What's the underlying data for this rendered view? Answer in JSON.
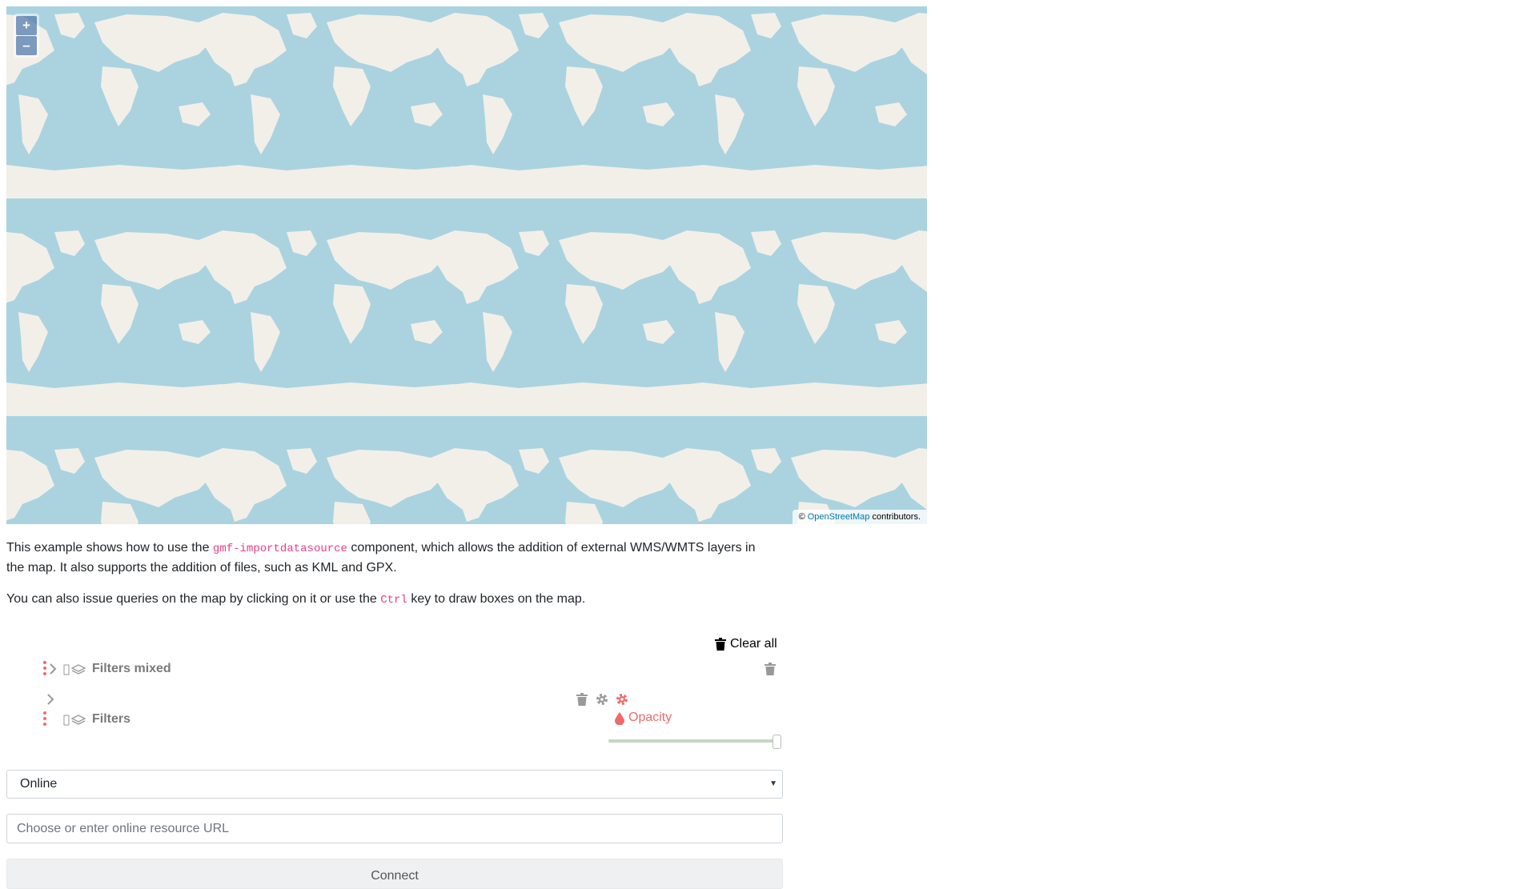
{
  "map": {
    "zoom_in": "+",
    "zoom_out": "–",
    "attribution_prefix": "©",
    "attribution_link": "OpenStreetMap",
    "attribution_suffix": "contributors.",
    "colors": {
      "water": "#aad3df",
      "land": "#f2efe9"
    }
  },
  "description": {
    "p1_before": "This example shows how to use the",
    "p1_code": "gmf-importdatasource",
    "p1_after": "component, which allows the addition of external WMS/WMTS layers in the map. It also supports the addition of files, such as KML and GPX.",
    "p2_before": "You can also issue queries on the map by clicking on it or use the",
    "p2_code": "Ctrl",
    "p2_after": "key to draw boxes on the map."
  },
  "layertree": {
    "clear_all": "Clear all",
    "rows": [
      {
        "label": "Filters mixed"
      },
      {
        "label": "Filters",
        "opacity_label": "Opacity",
        "opacity": 1.0
      }
    ],
    "accent_color": "#ef6a6a"
  },
  "import": {
    "source_selected": "Online",
    "url_placeholder": "Choose or enter online resource URL",
    "connect_label": "Connect"
  }
}
